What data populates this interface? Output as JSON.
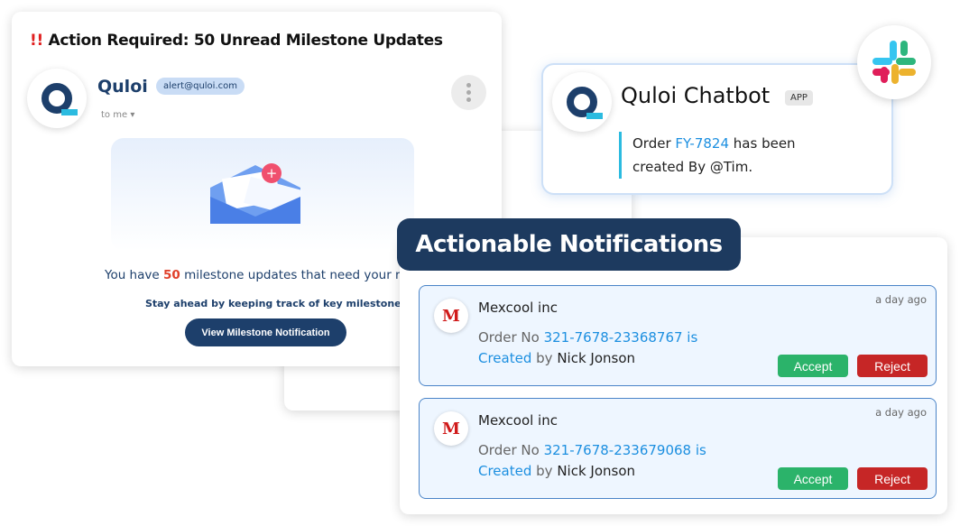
{
  "email": {
    "title_mark": "!!",
    "title": "Action Required: 50 Unread Milestone Updates",
    "sender": "Quloi",
    "sender_email": "alert@quloi.com",
    "recipient": "to me",
    "message_pre": "You have ",
    "message_count": "50",
    "message_post": " milestone updates that need your review.",
    "subtext": "Stay ahead by keeping track of key milestones.",
    "button": "View Milestone Notification"
  },
  "chat": {
    "name": "Quloi Chatbot",
    "badge": "APP",
    "msg_pre": "Order ",
    "order_id": "FY-7824",
    "msg_post": " has been created By @Tim."
  },
  "panel": {
    "heading": "Actionable Notifications",
    "items": [
      {
        "company": "Mexcool inc",
        "time": "a day ago",
        "pre": "Order No ",
        "order": "321-7678-23368767 is Created",
        "by": " by ",
        "user": "Nick Jonson",
        "accept": "Accept",
        "reject": "Reject",
        "logo": "M"
      },
      {
        "company": "Mexcool inc",
        "time": "a day ago",
        "pre": "Order No ",
        "order": "321-7678-233679068 is Created",
        "by": " by ",
        "user": "Nick Jonson",
        "accept": "Accept",
        "reject": "Reject",
        "logo": "M"
      }
    ]
  },
  "colors": {
    "navy": "#1d3a5f",
    "accent": "#1c8fe0",
    "accept": "#2bb36a",
    "reject": "#c62626"
  }
}
